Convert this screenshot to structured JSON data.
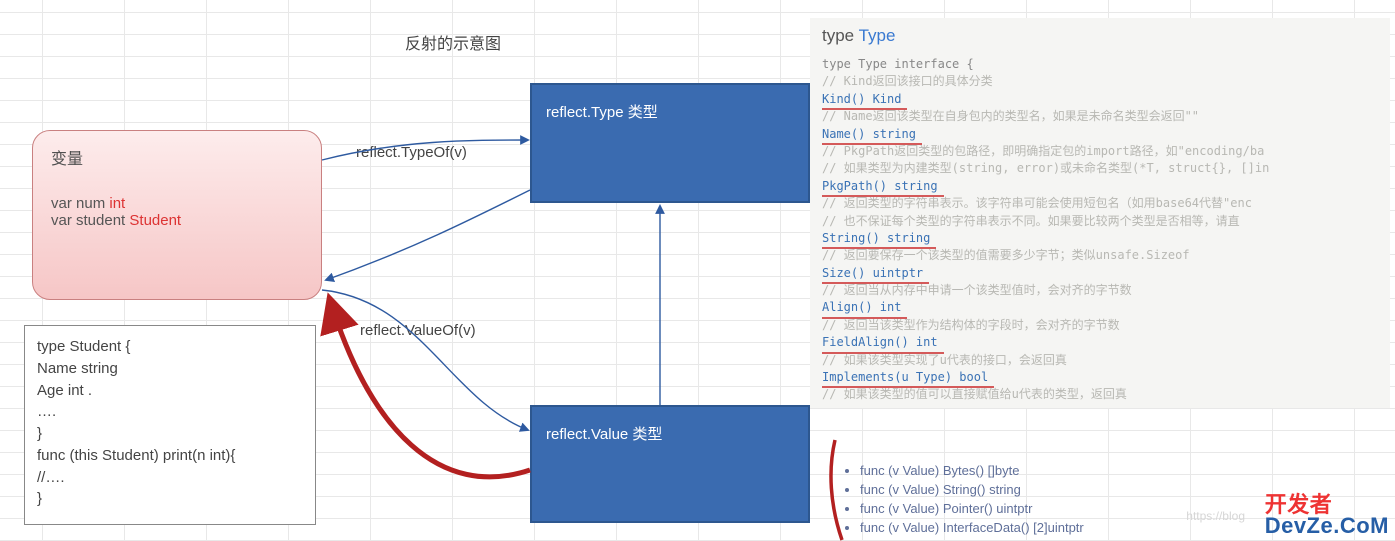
{
  "title": "反射的示意图",
  "var_box": {
    "heading": "变量",
    "line1_pre": "var num ",
    "line1_kw": "int",
    "line2_pre": "var student ",
    "line2_kw": "Student"
  },
  "struct_box": {
    "l1": "type  Student {",
    "l2": "Name string",
    "l3": "Age int .",
    "l4": "….",
    "l5": "}",
    "l6": "func  (this Student)    print(n int){",
    "l7": "//….",
    "l8": "}"
  },
  "blue_type": "reflect.Type 类型",
  "blue_value": "reflect.Value 类型",
  "fn_typeof": "reflect.TypeOf(v)",
  "fn_valueof": "reflect.ValueOf(v)",
  "doc": {
    "title_plain": "type ",
    "title_link": "Type",
    "l0": "type Type interface {",
    "c1": "// Kind返回该接口的具体分类",
    "s1": "Kind() Kind",
    "c2": "// Name返回该类型在自身包内的类型名，如果是未命名类型会返回\"\"",
    "s2": "Name() string",
    "c3": "// PkgPath返回类型的包路径，即明确指定包的import路径，如\"encoding/ba",
    "c3b": "// 如果类型为内建类型(string, error)或未命名类型(*T, struct{}, []in",
    "s3": "PkgPath() string",
    "c4": "// 返回类型的字符串表示。该字符串可能会使用短包名（如用base64代替\"enc",
    "c4b": "// 也不保证每个类型的字符串表示不同。如果要比较两个类型是否相等，请直",
    "s4": "String() string",
    "c5": "// 返回要保存一个该类型的值需要多少字节；类似unsafe.Sizeof",
    "s5": "Size() uintptr",
    "c6": "// 返回当从内存中申请一个该类型值时，会对齐的字节数",
    "s6": "Align() int",
    "c7": "// 返回当该类型作为结构体的字段时，会对齐的字节数",
    "s7": "FieldAlign() int",
    "c8": "// 如果该类型实现了u代表的接口，会返回真",
    "s8": "Implements(u Type) bool",
    "c9": "// 如果该类型的值可以直接赋值给u代表的类型，返回真"
  },
  "value_funcs": [
    "func (v Value) Bytes() []byte",
    "func (v Value) String() string",
    "func (v Value) Pointer() uintptr",
    "func (v Value) InterfaceData() [2]uintptr"
  ],
  "watermark": {
    "a": "开发者",
    "b": "DevZe.CoM",
    "blog": "https://blog"
  }
}
